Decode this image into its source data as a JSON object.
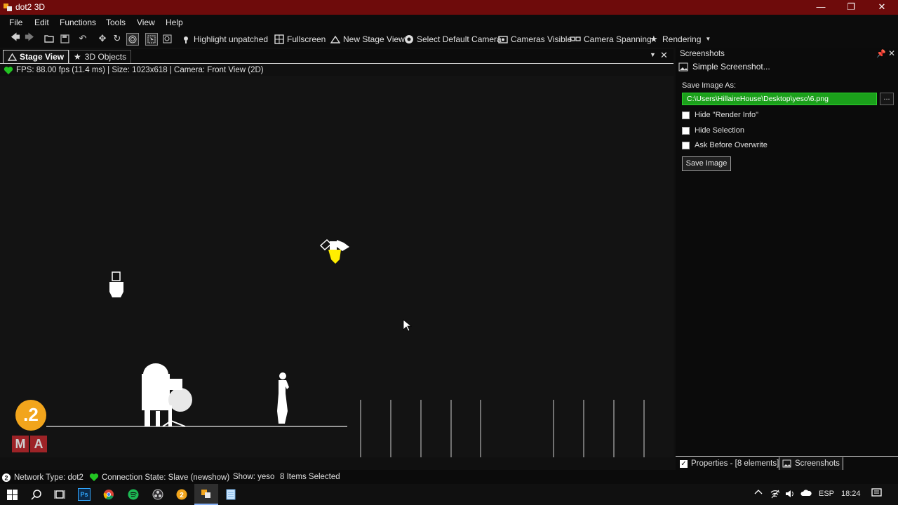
{
  "window": {
    "title": "dot2 3D",
    "minimize": "—",
    "restore": "❐",
    "close": "✕"
  },
  "menu": [
    "File",
    "Edit",
    "Functions",
    "Tools",
    "View",
    "Help"
  ],
  "toolbar": {
    "highlight_unpatched": "Highlight unpatched",
    "fullscreen": "Fullscreen",
    "new_stage_view": "New Stage View",
    "select_default_camera": "Select Default Camera",
    "cameras_visible": "Cameras Visible",
    "camera_spanning": "Camera Spanning",
    "rendering": "Rendering"
  },
  "tabs": {
    "stage_view": "Stage View",
    "objects_3d": "3D Objects"
  },
  "status_line": "FPS: 88.00 fps (11.4 ms) | Size: 1023x618 | Camera: Front View (2D)",
  "screenshots_panel": {
    "title": "Screenshots",
    "subtitle": "Simple Screenshot...",
    "save_image_as_label": "Save Image As:",
    "path_value": "C:\\Users\\HillaireHouse\\Desktop\\yeso\\6.png",
    "browse": "...",
    "options": [
      "Hide \"Render Info\"",
      "Hide Selection",
      "Ask Before Overwrite"
    ],
    "save_button": "Save Image"
  },
  "right_tabs": {
    "properties": "Properties - [8 elements]",
    "screenshots": "Screenshots"
  },
  "bottom_status": {
    "network_type": "Network Type: dot2",
    "connection_state": "Connection State: Slave (newshow)",
    "show": "Show: yeso",
    "selection": "8 Items Selected"
  },
  "logo": {
    "number": ".2",
    "letters": [
      "M",
      "A"
    ]
  },
  "tray": {
    "lang": "ESP",
    "time": "18:24"
  },
  "colors": {
    "titlebar": "#6e0b0b",
    "accent_green": "#1ba01b",
    "ok_green": "#22c422",
    "fixture_yellow": "#ffee00",
    "logo_orange": "#f2a51c",
    "logo_red": "#c0272d"
  }
}
